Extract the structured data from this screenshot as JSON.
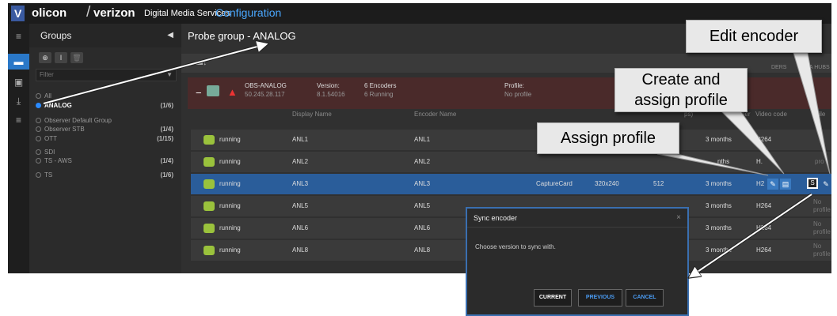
{
  "header": {
    "logo_text": "V",
    "brand_part1": "olicon",
    "brand_slash": "/",
    "brand_part2": "verizon",
    "brand_tag": "✓",
    "service": "Digital Media Services",
    "section": "Configuration"
  },
  "groups": {
    "title": "Groups",
    "filter_placeholder": "Filter",
    "items": [
      {
        "label": "All",
        "count": ""
      },
      {
        "label": "ANALOG",
        "count": "(1/6)",
        "selected": true
      },
      {
        "label": "Observer Default Group",
        "count": ""
      },
      {
        "label": "Observer STB",
        "count": "(1/4)"
      },
      {
        "label": "OTT",
        "count": "(1/15)"
      },
      {
        "label": "SDI",
        "count": ""
      },
      {
        "label": "TS - AWS",
        "count": "(1/4)"
      },
      {
        "label": "TS",
        "count": "(1/6)"
      }
    ]
  },
  "main": {
    "title": "Probe group - ANALOG",
    "column_right_1": "DERS",
    "column_right_2": "A HUBS",
    "probe": {
      "name": "OBS-ANALOG",
      "ip": "50.245.28.117",
      "version_label": "Version:",
      "version_value": "8.1.54016",
      "encoders_label": "6 Encoders",
      "running_label": "6 Running",
      "profile_label": "Profile:",
      "profile_value": "No profile"
    },
    "columns": {
      "display_name": "Display Name",
      "encoder_name": "Encoder Name",
      "bitrate": "ps)",
      "storage": "per",
      "video_codec": "Video code",
      "profile": "rofile"
    },
    "rows": [
      {
        "status": "running",
        "display": "ANL1",
        "encoder": "ANL1",
        "source": "",
        "resolution": "",
        "bitrate": "",
        "storage": "3 months",
        "codec": "H264",
        "profile": ""
      },
      {
        "status": "running",
        "display": "ANL2",
        "encoder": "ANL2",
        "source": "",
        "resolution": "",
        "bitrate": "",
        "storage": "nths",
        "codec": "H.",
        "profile": "pro"
      },
      {
        "status": "running",
        "display": "ANL3",
        "encoder": "ANL3",
        "source": "CaptureCard",
        "resolution": "320x240",
        "bitrate": "512",
        "storage": "3 months",
        "codec": "H2",
        "profile": ""
      },
      {
        "status": "running",
        "display": "ANL5",
        "encoder": "ANL5",
        "source": "",
        "resolution": "",
        "bitrate": "",
        "storage": "3 months",
        "codec": "H264",
        "profile": "No profile"
      },
      {
        "status": "running",
        "display": "ANL6",
        "encoder": "ANL6",
        "source": "",
        "resolution": "",
        "bitrate": "",
        "storage": "3 months",
        "codec": "H264",
        "profile": "No profile"
      },
      {
        "status": "running",
        "display": "ANL8",
        "encoder": "ANL8",
        "source": "",
        "resolution": "",
        "bitrate": "",
        "storage": "3 months",
        "codec": "H264",
        "profile": "No profile"
      }
    ]
  },
  "dialog": {
    "title": "Sync encoder",
    "close": "×",
    "message": "Choose version to sync with.",
    "btn_current": "CURRENT",
    "btn_previous": "PREVIOUS",
    "btn_cancel": "CANCEL"
  },
  "callouts": {
    "edit_encoder": "Edit encoder",
    "create_assign": "Create and\nassign profile",
    "assign_profile": "Assign profile"
  },
  "icons": {
    "sync_label": "S"
  },
  "colors": {
    "accent": "#2a78c8",
    "warning": "#e33333",
    "running": "#9ac23c"
  }
}
